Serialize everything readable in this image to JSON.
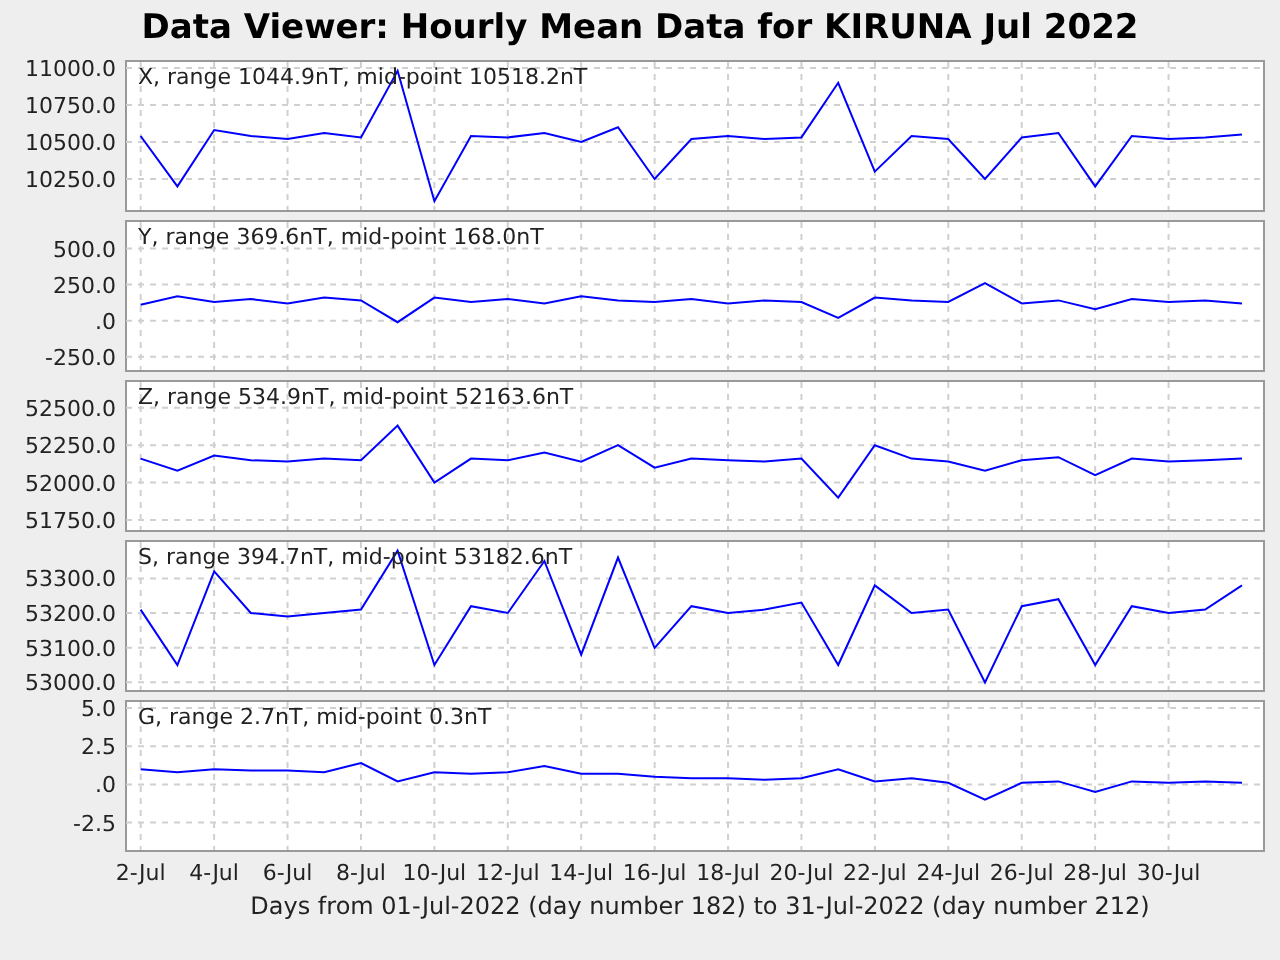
{
  "window": {
    "title": "Data Viewer:  Hourly Mean Data for KIRUNA Jul 2022"
  },
  "panels": [
    {
      "chart_data": {
        "type": "line",
        "title": "X, range 1044.9nT, mid-point 10518.2nT",
        "grid": true,
        "ylim": [
          10040,
          11040
        ],
        "yticks": [
          {
            "value": 11000,
            "label": "11000.0"
          },
          {
            "value": 10750,
            "label": "10750.0"
          },
          {
            "value": 10500,
            "label": "10500.0"
          },
          {
            "value": 10250,
            "label": "10250.0"
          }
        ],
        "series": [
          {
            "color": "#0000ff",
            "values": [
              10540,
              10200,
              10580,
              10540,
              10520,
              10560,
              10530,
              10980,
              10100,
              10540,
              10530,
              10560,
              10500,
              10600,
              10250,
              10520,
              10540,
              10520,
              10530,
              10900,
              10300,
              10540,
              10520,
              10250,
              10530,
              10560,
              10200,
              10540,
              10520,
              10530,
              10550
            ]
          }
        ]
      }
    },
    {
      "chart_data": {
        "type": "line",
        "title": "Y, range 369.6nT, mid-point 168.0nT",
        "grid": true,
        "ylim": [
          -342,
          684
        ],
        "yticks": [
          {
            "value": 500,
            "label": "500.0"
          },
          {
            "value": 250,
            "label": "250.0"
          },
          {
            "value": 0,
            "label": ".0"
          },
          {
            "value": -250,
            "label": "-250.0"
          }
        ],
        "series": [
          {
            "color": "#0000ff",
            "values": [
              110,
              170,
              130,
              150,
              120,
              160,
              140,
              -10,
              160,
              130,
              150,
              120,
              170,
              140,
              130,
              150,
              120,
              140,
              130,
              20,
              160,
              140,
              130,
              260,
              120,
              140,
              80,
              150,
              130,
              140,
              120
            ]
          }
        ]
      }
    },
    {
      "chart_data": {
        "type": "line",
        "title": "Z, range 534.9nT, mid-point 52163.6nT",
        "grid": true,
        "ylim": [
          51684,
          52671
        ],
        "yticks": [
          {
            "value": 52500,
            "label": "52500.0"
          },
          {
            "value": 52250,
            "label": "52250.0"
          },
          {
            "value": 52000,
            "label": "52000.0"
          },
          {
            "value": 51750,
            "label": "51750.0"
          }
        ],
        "series": [
          {
            "color": "#0000ff",
            "values": [
              52160,
              52080,
              52180,
              52150,
              52140,
              52160,
              52150,
              52380,
              52000,
              52160,
              52150,
              52200,
              52140,
              52250,
              52100,
              52160,
              52150,
              52140,
              52160,
              51900,
              52250,
              52160,
              52140,
              52080,
              52150,
              52170,
              52050,
              52160,
              52140,
              52150,
              52160
            ]
          }
        ]
      }
    },
    {
      "chart_data": {
        "type": "line",
        "title": "S, range 394.7nT, mid-point 53182.6nT",
        "grid": true,
        "ylim": [
          52978,
          53405
        ],
        "yticks": [
          {
            "value": 53300,
            "label": "53300.0"
          },
          {
            "value": 53200,
            "label": "53200.0"
          },
          {
            "value": 53100,
            "label": "53100.0"
          },
          {
            "value": 53000,
            "label": "53000.0"
          }
        ],
        "series": [
          {
            "color": "#0000ff",
            "values": [
              53210,
              53050,
              53320,
              53200,
              53190,
              53200,
              53210,
              53380,
              53050,
              53220,
              53200,
              53350,
              53080,
              53360,
              53100,
              53220,
              53200,
              53210,
              53230,
              53050,
              53280,
              53200,
              53210,
              53000,
              53220,
              53240,
              53050,
              53220,
              53200,
              53210,
              53280
            ]
          }
        ]
      }
    },
    {
      "chart_data": {
        "type": "line",
        "title": "G, range 2.7nT, mid-point 0.3nT",
        "grid": true,
        "ylim": [
          -4.3,
          5.4
        ],
        "xlabel": "Days from 01-Jul-2022 (day number 182) to 31-Jul-2022 (day number 212)",
        "categories": [
          "2-Jul",
          null,
          "4-Jul",
          null,
          "6-Jul",
          null,
          "8-Jul",
          null,
          "10-Jul",
          null,
          "12-Jul",
          null,
          "14-Jul",
          null,
          "16-Jul",
          null,
          "18-Jul",
          null,
          "20-Jul",
          null,
          "22-Jul",
          null,
          "24-Jul",
          null,
          "26-Jul",
          null,
          "28-Jul",
          null,
          "30-Jul",
          null,
          null
        ],
        "yticks": [
          {
            "value": 5,
            "label": "5.0"
          },
          {
            "value": 2.5,
            "label": "2.5"
          },
          {
            "value": 0,
            "label": ".0"
          },
          {
            "value": -2.5,
            "label": "-2.5"
          }
        ],
        "series": [
          {
            "color": "#0000ff",
            "values": [
              1.0,
              0.8,
              1.0,
              0.9,
              0.9,
              0.8,
              1.4,
              0.2,
              0.8,
              0.7,
              0.8,
              1.2,
              0.7,
              0.7,
              0.5,
              0.4,
              0.4,
              0.3,
              0.4,
              1.0,
              0.2,
              0.4,
              0.1,
              -1.0,
              0.1,
              0.2,
              -0.5,
              0.2,
              0.1,
              0.2,
              0.1
            ]
          }
        ]
      }
    }
  ]
}
